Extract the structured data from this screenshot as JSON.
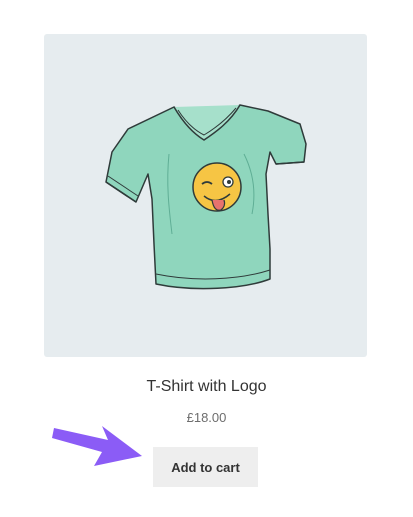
{
  "product": {
    "name": "T-Shirt with Logo",
    "price": "£18.00",
    "add_to_cart_label": "Add to cart",
    "image_icon": "tshirt-with-winking-emoji-image",
    "image_background": "#e6ecef",
    "shirt_color": "#8fd6bd",
    "emoji_color": "#f6c544"
  },
  "annotation": {
    "arrow_icon": "pointer-arrow",
    "arrow_color": "#8b5cf6"
  }
}
